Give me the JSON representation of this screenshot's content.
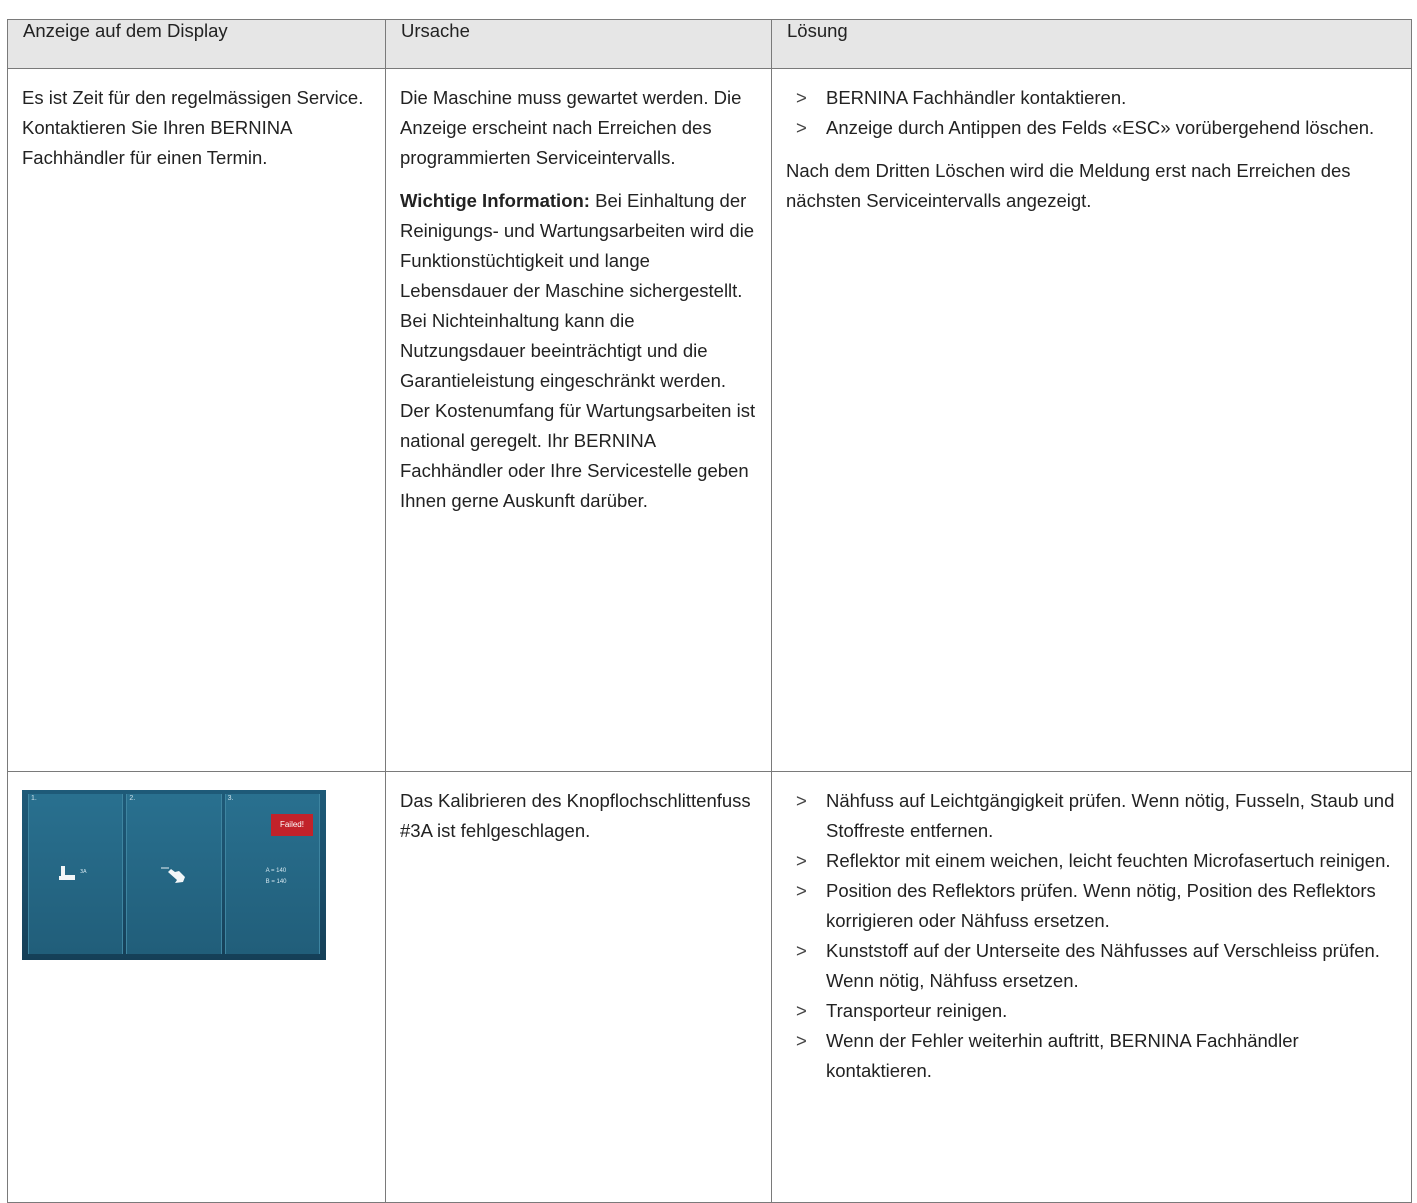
{
  "table": {
    "headers": [
      "Anzeige auf dem Display",
      "Ursache",
      "Lösung"
    ],
    "row1": {
      "display_text": "Es ist Zeit für den regelmässigen Service. Kontaktieren Sie Ihren BERNINA Fachhändler für einen Termin.",
      "cause_intro": "Die Maschine muss gewartet werden. Die Anzeige erscheint nach Erreichen des programmierten Serviceintervalls.",
      "cause_note_label": "Wichtige Information:",
      "cause_note_text": " Bei Einhaltung der Reinigungs- und Wartungsarbeiten wird die Funktionstüchtigkeit und lange Lebensdauer der Maschine sichergestellt. Bei Nichteinhaltung kann die Nutzungsdauer beeinträchtigt und die Garantieleistung eingeschränkt werden. Der Kostenumfang für Wartungsarbeiten ist national geregelt. Ihr BERNINA Fachhändler oder Ihre Servicestelle geben Ihnen gerne Auskunft darüber.",
      "solution_steps": [
        "BERNINA Fachhändler kontaktieren.",
        "Anzeige durch Antippen des Felds «ESC» vorübergehend löschen."
      ],
      "solution_note": "Nach dem Dritten Löschen wird die Meldung erst nach Erreichen des nächsten Serviceintervalls angezeigt."
    },
    "row2": {
      "screenshot": {
        "panels": [
          "1.",
          "2.",
          "3."
        ],
        "status_label": "Failed!",
        "measure_a": "A = 140",
        "measure_b": "B = 140",
        "foot_label": "3A",
        "icons": [
          "presser-foot-icon",
          "touch-hand-icon"
        ],
        "colors": {
          "background": "#1a4d69",
          "failed": "#c2222a"
        }
      },
      "cause": "Das Kalibrieren des Knopflochschlittenfuss #3A ist fehlgeschlagen.",
      "solution_steps": [
        "Nähfuss auf Leichtgängigkeit prüfen. Wenn nötig, Fusseln, Staub und Stoffreste entfernen.",
        "Reflektor mit einem weichen, leicht feuchten Microfasertuch reinigen.",
        "Position des Reflektors prüfen. Wenn nötig, Position des Reflektors korrigieren oder Nähfuss ersetzen.",
        "Kunststoff auf der Unterseite des Nähfusses auf Verschleiss prüfen. Wenn nötig, Nähfuss ersetzen.",
        "Transporteur reinigen.",
        "Wenn der Fehler weiterhin auftritt, BERNINA Fachhändler kontaktieren."
      ]
    },
    "bullet_marker": ">"
  }
}
